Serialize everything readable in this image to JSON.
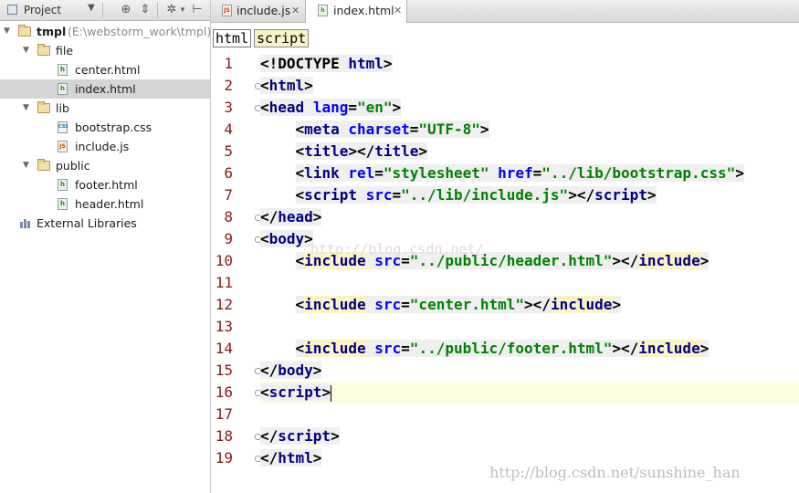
{
  "project_panel": {
    "title": "Project",
    "tree": [
      {
        "name": "tmpl",
        "hint": "(E:\\webstorm_work\\tmpl)",
        "kind": "folder",
        "depth": 0,
        "expanded": true,
        "bold": true
      },
      {
        "name": "file",
        "kind": "folder",
        "depth": 1,
        "expanded": true
      },
      {
        "name": "center.html",
        "kind": "html",
        "depth": 2
      },
      {
        "name": "index.html",
        "kind": "html",
        "depth": 2,
        "selected": true
      },
      {
        "name": "lib",
        "kind": "folder",
        "depth": 1,
        "expanded": true
      },
      {
        "name": "bootstrap.css",
        "kind": "css",
        "depth": 2
      },
      {
        "name": "include.js",
        "kind": "js",
        "depth": 2
      },
      {
        "name": "public",
        "kind": "folder",
        "depth": 1,
        "expanded": true
      },
      {
        "name": "footer.html",
        "kind": "html",
        "depth": 2
      },
      {
        "name": "header.html",
        "kind": "html",
        "depth": 2
      },
      {
        "name": "External Libraries",
        "kind": "library",
        "depth": 0
      }
    ]
  },
  "tabs": [
    {
      "label": "include.js",
      "kind": "js",
      "active": false
    },
    {
      "label": "index.html",
      "kind": "html",
      "active": true
    }
  ],
  "breadcrumb": [
    "html",
    "script"
  ],
  "editor": {
    "current_line": 16,
    "lines": [
      {
        "n": "1",
        "tokens": [
          [
            "p",
            "<!DOCTYPE "
          ],
          [
            "t",
            "html"
          ],
          [
            "p",
            ">"
          ]
        ]
      },
      {
        "n": "2",
        "fold": true,
        "tokens": [
          [
            "p",
            "<"
          ],
          [
            "t",
            "html"
          ],
          [
            "p",
            ">"
          ]
        ]
      },
      {
        "n": "3",
        "fold": true,
        "tokens": [
          [
            "p",
            "<"
          ],
          [
            "t",
            "head "
          ],
          [
            "a",
            "lang"
          ],
          [
            "p",
            "="
          ],
          [
            "s",
            "\"en\""
          ],
          [
            "p",
            ">"
          ]
        ]
      },
      {
        "n": "4",
        "tokens": [
          [
            "i",
            "    "
          ],
          [
            "p",
            "<"
          ],
          [
            "t",
            "meta "
          ],
          [
            "a",
            "charset"
          ],
          [
            "p",
            "="
          ],
          [
            "s",
            "\"UTF-8\""
          ],
          [
            "p",
            ">"
          ]
        ]
      },
      {
        "n": "5",
        "tokens": [
          [
            "i",
            "    "
          ],
          [
            "p",
            "<"
          ],
          [
            "t",
            "title"
          ],
          [
            "p",
            "></"
          ],
          [
            "t",
            "title"
          ],
          [
            "p",
            ">"
          ]
        ]
      },
      {
        "n": "6",
        "tokens": [
          [
            "i",
            "    "
          ],
          [
            "p",
            "<"
          ],
          [
            "t",
            "link "
          ],
          [
            "a",
            "rel"
          ],
          [
            "p",
            "="
          ],
          [
            "s",
            "\"stylesheet\" "
          ],
          [
            "a",
            "href"
          ],
          [
            "p",
            "="
          ],
          [
            "s",
            "\"../lib/bootstrap.css\""
          ],
          [
            "p",
            ">"
          ]
        ]
      },
      {
        "n": "7",
        "tokens": [
          [
            "i",
            "    "
          ],
          [
            "p",
            "<"
          ],
          [
            "t",
            "script "
          ],
          [
            "a",
            "src"
          ],
          [
            "p",
            "="
          ],
          [
            "s",
            "\"../lib/include.js\""
          ],
          [
            "p",
            "></"
          ],
          [
            "t",
            "script"
          ],
          [
            "p",
            ">"
          ]
        ]
      },
      {
        "n": "8",
        "fold": true,
        "tokens": [
          [
            "p",
            "</"
          ],
          [
            "t",
            "head"
          ],
          [
            "p",
            ">"
          ]
        ]
      },
      {
        "n": "9",
        "fold": true,
        "tokens": [
          [
            "p",
            "<"
          ],
          [
            "t",
            "body"
          ],
          [
            "p",
            ">"
          ]
        ]
      },
      {
        "n": "10",
        "tokens": [
          [
            "i",
            "    "
          ],
          [
            "p",
            "<"
          ],
          [
            "y",
            "include"
          ],
          [
            "p",
            " "
          ],
          [
            "a",
            "src"
          ],
          [
            "p",
            "="
          ],
          [
            "s",
            "\"../public/header.html\""
          ],
          [
            "p",
            "></"
          ],
          [
            "y",
            "include"
          ],
          [
            "p",
            ">"
          ]
        ]
      },
      {
        "n": "11",
        "tokens": []
      },
      {
        "n": "12",
        "tokens": [
          [
            "i",
            "    "
          ],
          [
            "p",
            "<"
          ],
          [
            "y",
            "include"
          ],
          [
            "p",
            " "
          ],
          [
            "a",
            "src"
          ],
          [
            "p",
            "="
          ],
          [
            "s",
            "\"center.html\""
          ],
          [
            "p",
            "></"
          ],
          [
            "y",
            "include"
          ],
          [
            "p",
            ">"
          ]
        ]
      },
      {
        "n": "13",
        "tokens": []
      },
      {
        "n": "14",
        "tokens": [
          [
            "i",
            "    "
          ],
          [
            "p",
            "<"
          ],
          [
            "y",
            "include"
          ],
          [
            "p",
            " "
          ],
          [
            "a",
            "src"
          ],
          [
            "p",
            "="
          ],
          [
            "s",
            "\"../public/footer.html\""
          ],
          [
            "p",
            "></"
          ],
          [
            "y",
            "include"
          ],
          [
            "p",
            ">"
          ]
        ]
      },
      {
        "n": "15",
        "fold": true,
        "tokens": [
          [
            "p",
            "</"
          ],
          [
            "t",
            "body"
          ],
          [
            "p",
            ">"
          ]
        ]
      },
      {
        "n": "16",
        "fold": true,
        "tokens": [
          [
            "p",
            "<"
          ],
          [
            "t",
            "script"
          ],
          [
            "p",
            ">"
          ],
          [
            "c",
            ""
          ]
        ]
      },
      {
        "n": "17",
        "tokens": []
      },
      {
        "n": "18",
        "fold": true,
        "tokens": [
          [
            "p",
            "</"
          ],
          [
            "t",
            "script"
          ],
          [
            "p",
            ">"
          ]
        ]
      },
      {
        "n": "19",
        "fold": true,
        "tokens": [
          [
            "p",
            "</"
          ],
          [
            "t",
            "html"
          ],
          [
            "p",
            ">"
          ]
        ]
      }
    ]
  },
  "watermark": {
    "faint": "http://blog.csdn.net/",
    "corner": "http://blog.csdn.net/sunshine_han"
  },
  "colors": {
    "tag": "#000080",
    "attr": "#0000ff",
    "string": "#008000",
    "line_number": "#8b1a1a",
    "current_line_bg": "#fdfbe0"
  }
}
